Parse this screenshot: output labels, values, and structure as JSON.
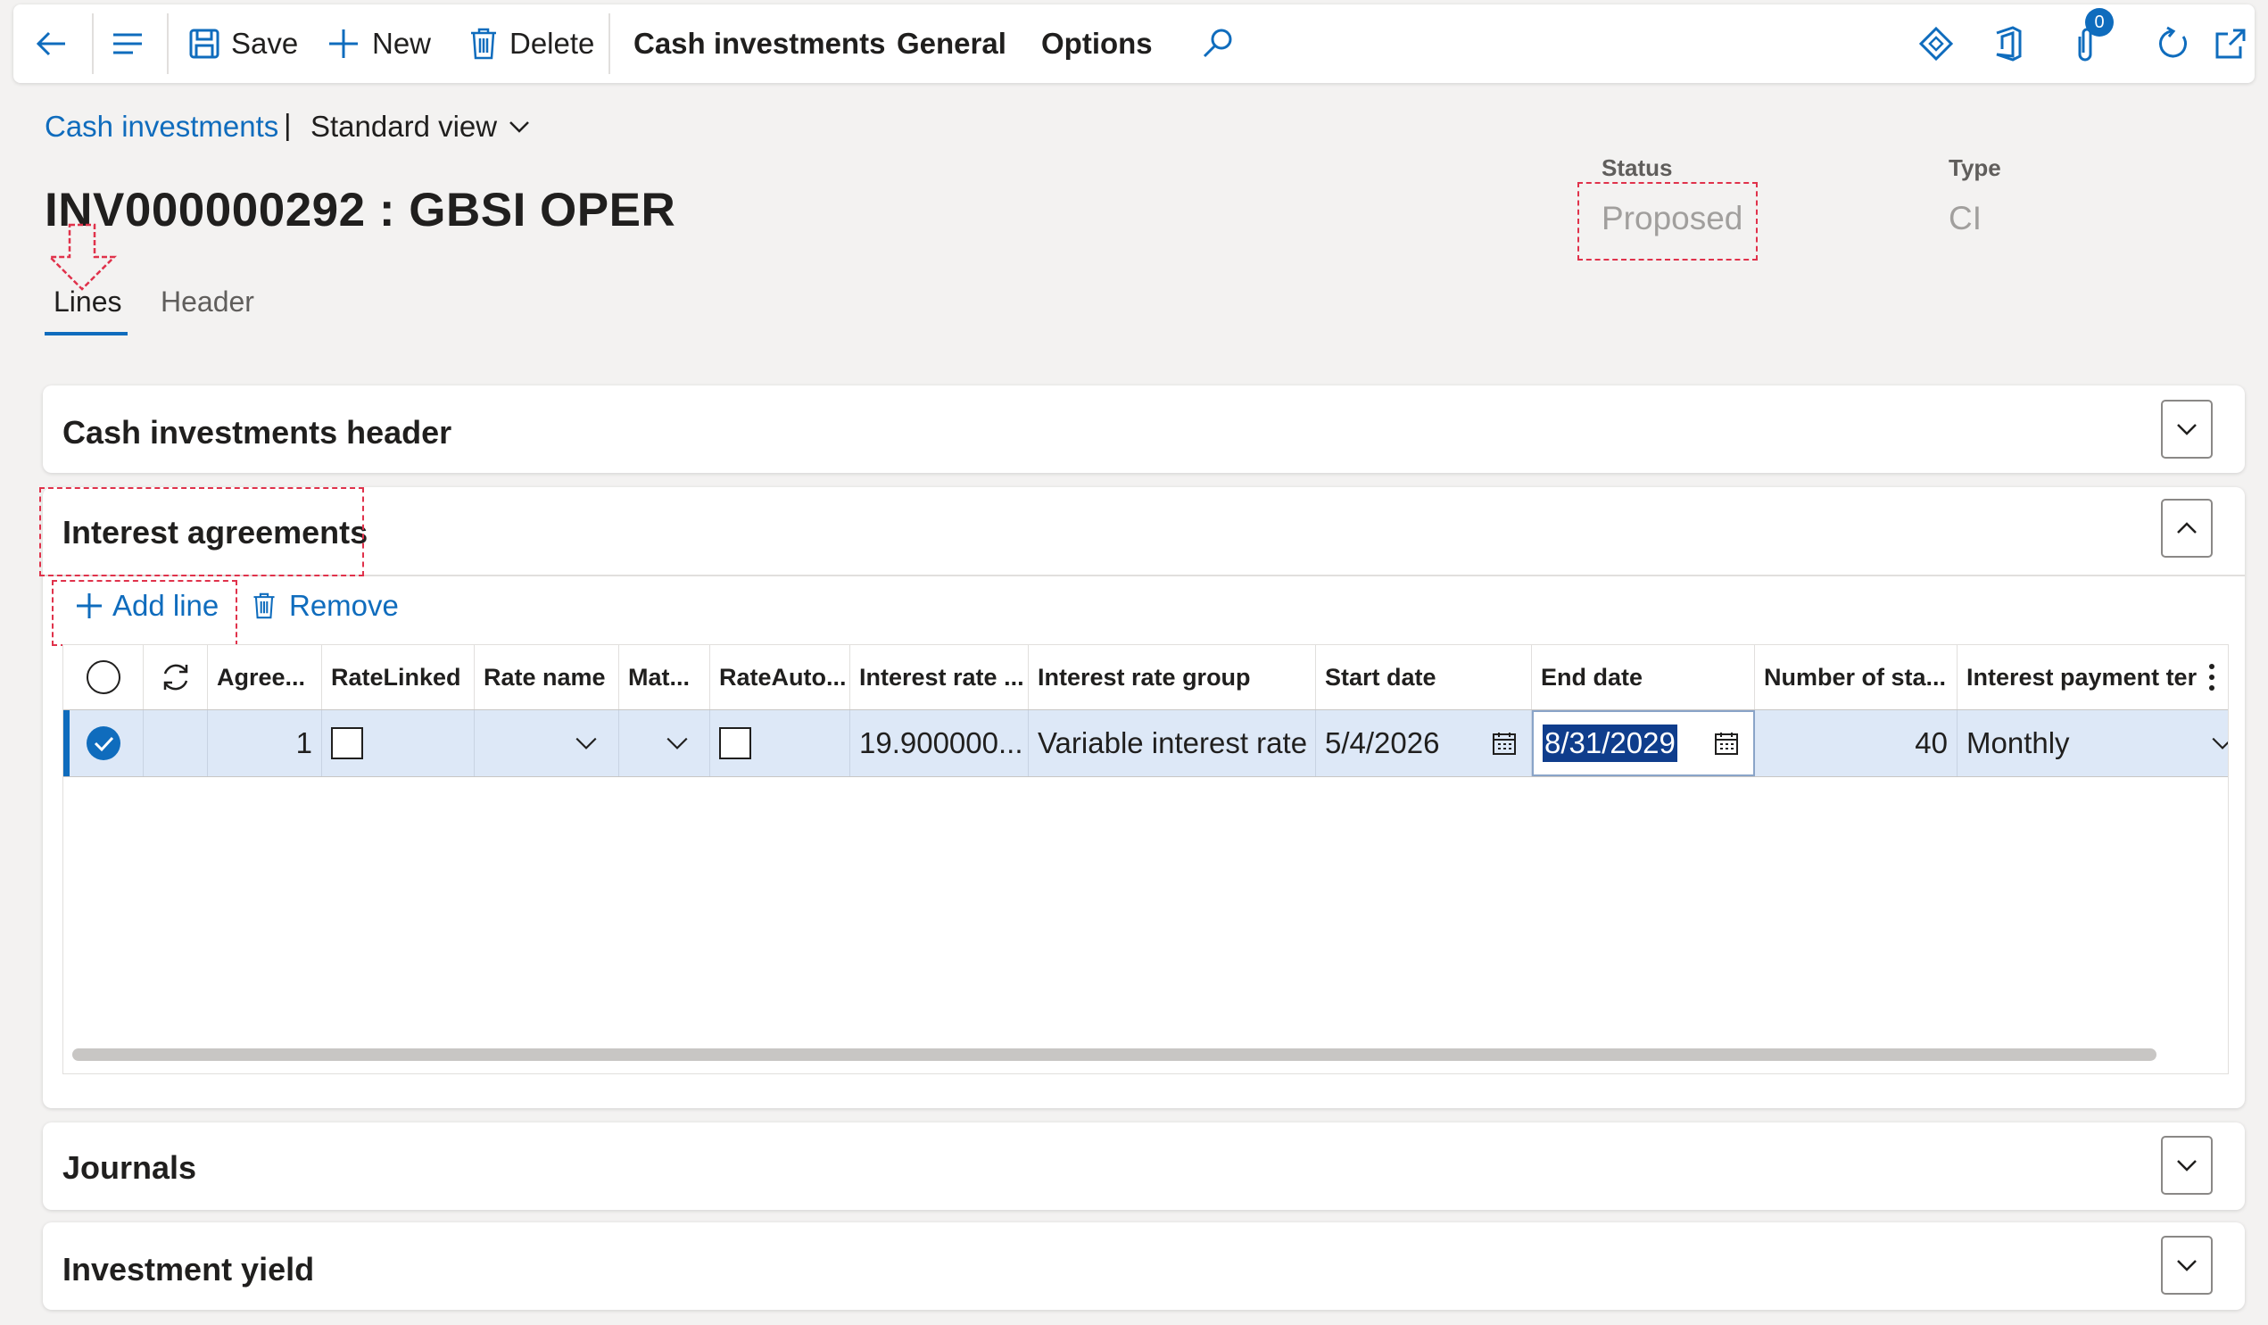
{
  "toolbar": {
    "save_label": "Save",
    "new_label": "New",
    "delete_label": "Delete",
    "menus": [
      "Cash investments",
      "General",
      "Options"
    ],
    "notification_count": "0"
  },
  "breadcrumb": {
    "link": "Cash investments",
    "separator": "|",
    "view": "Standard view"
  },
  "page": {
    "title": "INV000000292 : GBSI OPER",
    "status_label": "Status",
    "status_value": "Proposed",
    "type_label": "Type",
    "type_value": "CI"
  },
  "tabs": [
    "Lines",
    "Header"
  ],
  "sections": {
    "cash_header": "Cash investments header",
    "interest_agreements": "Interest agreements",
    "journals": "Journals",
    "investment_yield": "Investment yield"
  },
  "grid_actions": {
    "add_line": "Add line",
    "remove": "Remove"
  },
  "grid": {
    "columns": [
      "Agree...",
      "RateLinked",
      "Rate name",
      "Mat...",
      "RateAuto...",
      "Interest rate ...",
      "Interest rate group",
      "Start date",
      "End date",
      "Number of sta...",
      "Interest payment ter"
    ],
    "rows": [
      {
        "agreement": "1",
        "rate_linked": false,
        "rate_name": "",
        "maturity": "",
        "rate_auto": false,
        "interest_rate": "19.900000...",
        "interest_rate_group": "Variable interest rate",
        "start_date": "5/4/2026",
        "end_date": "8/31/2029",
        "number_of_statements": "40",
        "interest_payment_term": "Monthly"
      }
    ]
  },
  "colors": {
    "accent": "#0f6cbd",
    "selected_row": "#dde8f7",
    "annotation": "#e0324b"
  }
}
